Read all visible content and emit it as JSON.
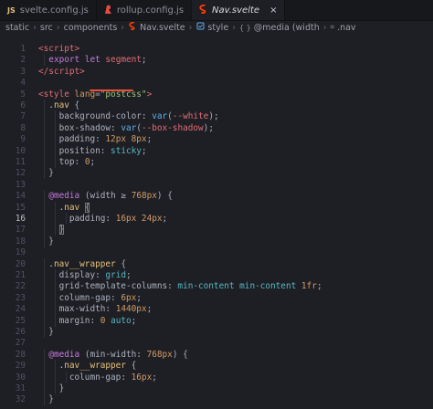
{
  "tabs": [
    {
      "badge": "JS",
      "label": "svelte.config.js",
      "icon": "js-file-icon"
    },
    {
      "badge": "",
      "label": "rollup.config.js",
      "icon": "rollup-file-icon"
    },
    {
      "badge": "",
      "label": "Nav.svelte",
      "icon": "svelte-file-icon",
      "close": "×"
    }
  ],
  "breadcrumb": [
    "static",
    "src",
    "components",
    "Nav.svelte",
    "style",
    "@media (width",
    ".nav"
  ],
  "breadcrumb_icons": {
    "media": "{ }",
    "nav": "⌗"
  },
  "lines": [
    {
      "n": "1",
      "html": "  <span class=\"t\">&lt;script&gt;</span>"
    },
    {
      "n": "2",
      "html": "    <span class=\"k\">export let</span> <span class=\"t\">segment</span><span class=\"p\">;</span>"
    },
    {
      "n": "3",
      "html": "  <span class=\"t\">&lt;/script&gt;</span>"
    },
    {
      "n": "4",
      "html": ""
    },
    {
      "n": "5",
      "html": "  <span class=\"t\">&lt;style</span> <span class=\"n\">lang</span><span class=\"p\">=</span><span class=\"s\">\"postcss\"</span><span class=\"t\">&gt;</span>"
    },
    {
      "n": "6",
      "html": "    <span class=\"sel\">.nav</span> <span class=\"p\">{</span>"
    },
    {
      "n": "7",
      "html": "      <span class=\"prop\">background-color</span><span class=\"p\">:</span> <span class=\"f\">var</span><span class=\"p\">(</span><span class=\"t\">--white</span><span class=\"p\">);</span>"
    },
    {
      "n": "8",
      "html": "      <span class=\"prop\">box-shadow</span><span class=\"p\">:</span> <span class=\"f\">var</span><span class=\"p\">(</span><span class=\"t\">--box-shadow</span><span class=\"p\">);</span>"
    },
    {
      "n": "9",
      "html": "      <span class=\"prop\">padding</span><span class=\"p\">:</span> <span class=\"n\">12px 8px</span><span class=\"p\">;</span>"
    },
    {
      "n": "10",
      "html": "      <span class=\"prop\">position</span><span class=\"p\">:</span> <span class=\"c\">sticky</span><span class=\"p\">;</span>"
    },
    {
      "n": "11",
      "html": "      <span class=\"prop\">top</span><span class=\"p\">:</span> <span class=\"n\">0</span><span class=\"p\">;</span>"
    },
    {
      "n": "12",
      "html": "    <span class=\"p\">}</span>"
    },
    {
      "n": "13",
      "html": ""
    },
    {
      "n": "14",
      "html": "    <span class=\"k\">@media</span> <span class=\"p\">(</span><span class=\"prop\">width</span> <span class=\"p\">≥</span> <span class=\"n\">768px</span><span class=\"p\">) {</span>"
    },
    {
      "n": "15",
      "html": "      <span class=\"sel\">.nav</span> <span class=\"p hl\">{</span>"
    },
    {
      "n": "16",
      "html": "        <span class=\"prop\">padding</span><span class=\"p\">:</span> <span class=\"n\">16px 24px</span><span class=\"p\">;</span>"
    },
    {
      "n": "17",
      "html": "      <span class=\"p hl\">}</span>"
    },
    {
      "n": "18",
      "html": "    <span class=\"p\">}</span>"
    },
    {
      "n": "19",
      "html": ""
    },
    {
      "n": "20",
      "html": "    <span class=\"sel\">.nav__wrapper</span> <span class=\"p\">{</span>"
    },
    {
      "n": "21",
      "html": "      <span class=\"prop\">display</span><span class=\"p\">:</span> <span class=\"c\">grid</span><span class=\"p\">;</span>"
    },
    {
      "n": "22",
      "html": "      <span class=\"prop\">grid-template-columns</span><span class=\"p\">:</span> <span class=\"c\">min-content min-content</span> <span class=\"n\">1fr</span><span class=\"p\">;</span>"
    },
    {
      "n": "23",
      "html": "      <span class=\"prop\">column-gap</span><span class=\"p\">:</span> <span class=\"n\">6px</span><span class=\"p\">;</span>"
    },
    {
      "n": "24",
      "html": "      <span class=\"prop\">max-width</span><span class=\"p\">:</span> <span class=\"n\">1440px</span><span class=\"p\">;</span>"
    },
    {
      "n": "25",
      "html": "      <span class=\"prop\">margin</span><span class=\"p\">:</span> <span class=\"n\">0</span> <span class=\"c\">auto</span><span class=\"p\">;</span>"
    },
    {
      "n": "26",
      "html": "    <span class=\"p\">}</span>"
    },
    {
      "n": "27",
      "html": ""
    },
    {
      "n": "28",
      "html": "    <span class=\"k\">@media</span> <span class=\"p\">(</span><span class=\"prop\">min-width</span><span class=\"p\">:</span> <span class=\"n\">768px</span><span class=\"p\">) {</span>"
    },
    {
      "n": "29",
      "html": "      <span class=\"sel\">.nav__wrapper</span> <span class=\"p\">{</span>"
    },
    {
      "n": "30",
      "html": "        <span class=\"prop\">column-gap</span><span class=\"p\">:</span> <span class=\"n\">16px</span><span class=\"p\">;</span>"
    },
    {
      "n": "31",
      "html": "      <span class=\"p\">}</span>"
    },
    {
      "n": "32",
      "html": "    <span class=\"p\">}</span>"
    }
  ],
  "cursor_line": "16",
  "colors": {
    "accent_underline": "#e8503a",
    "svelte": "#ff3e00",
    "js_badge": "#e5c07b",
    "background": "#1e1f24"
  }
}
